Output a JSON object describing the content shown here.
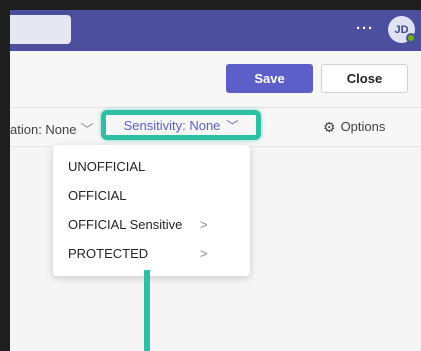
{
  "header": {
    "more_label": "···",
    "avatar_initials": "JD"
  },
  "actions": {
    "save_label": "Save",
    "close_label": "Close"
  },
  "toolbar": {
    "classification_label": "ation: None",
    "sensitivity_label": "Sensitivity: None",
    "options_label": "Options"
  },
  "sensitivity_menu": {
    "items": [
      {
        "label": "UNOFFICIAL",
        "submenu": ""
      },
      {
        "label": "OFFICIAL",
        "submenu": ""
      },
      {
        "label": "OFFICIAL Sensitive",
        "submenu": ">"
      },
      {
        "label": "PROTECTED",
        "submenu": ">"
      }
    ]
  },
  "colors": {
    "brand_bar": "#4b4f9e",
    "primary_button": "#5b5fc7",
    "highlight": "#2ebfa5"
  }
}
